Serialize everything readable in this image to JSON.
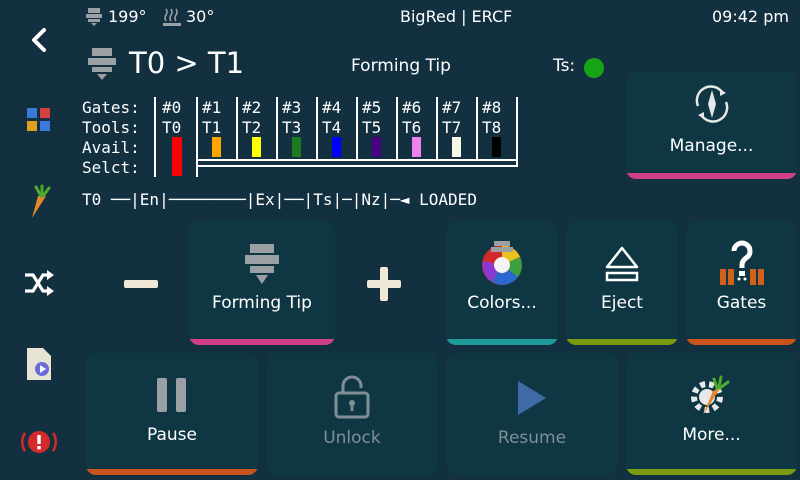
{
  "status": {
    "extruder_temp": "199°",
    "bed_temp": "30°",
    "title": "BigRed | ERCF",
    "time": "09:42 pm"
  },
  "header": {
    "tool_change": "T0 > T1",
    "action": "Forming Tip",
    "ts_label": "Ts:",
    "ts_color": "#16a316"
  },
  "gates": {
    "row_labels": [
      "Gates:",
      "Tools:",
      "Avail:",
      "Selct:"
    ],
    "columns": [
      {
        "gate": "#0",
        "tool": "T0",
        "color": "#ff0000",
        "selected": true
      },
      {
        "gate": "#1",
        "tool": "T1",
        "color": "#ffa500",
        "selected": false
      },
      {
        "gate": "#2",
        "tool": "T2",
        "color": "#ffff00",
        "selected": false
      },
      {
        "gate": "#3",
        "tool": "T3",
        "color": "#1e7a1e",
        "selected": false
      },
      {
        "gate": "#4",
        "tool": "T4",
        "color": "#0000ff",
        "selected": false
      },
      {
        "gate": "#5",
        "tool": "T5",
        "color": "#4b0082",
        "selected": false
      },
      {
        "gate": "#6",
        "tool": "T6",
        "color": "#ee82ee",
        "selected": false
      },
      {
        "gate": "#7",
        "tool": "T7",
        "color": "#f8f8e8",
        "selected": false
      },
      {
        "gate": "#8",
        "tool": "T8",
        "color": "#000000",
        "selected": false
      }
    ]
  },
  "filament_path": {
    "text": "T0 ──|En|────────|Ex|──|Ts|─|Nz|─◄ LOADED"
  },
  "buttons": {
    "manage": "Manage...",
    "forming_tip": "Forming Tip",
    "colors": "Colors...",
    "eject": "Eject",
    "gates": "Gates",
    "pause": "Pause",
    "unlock": "Unlock",
    "resume": "Resume",
    "more": "More..."
  },
  "colors": {
    "magenta": "#d0408a",
    "teal": "#1f9a9a",
    "olive": "#7a9a10",
    "orange": "#c9531a",
    "background": "#12303f",
    "button": "#0f3743"
  }
}
